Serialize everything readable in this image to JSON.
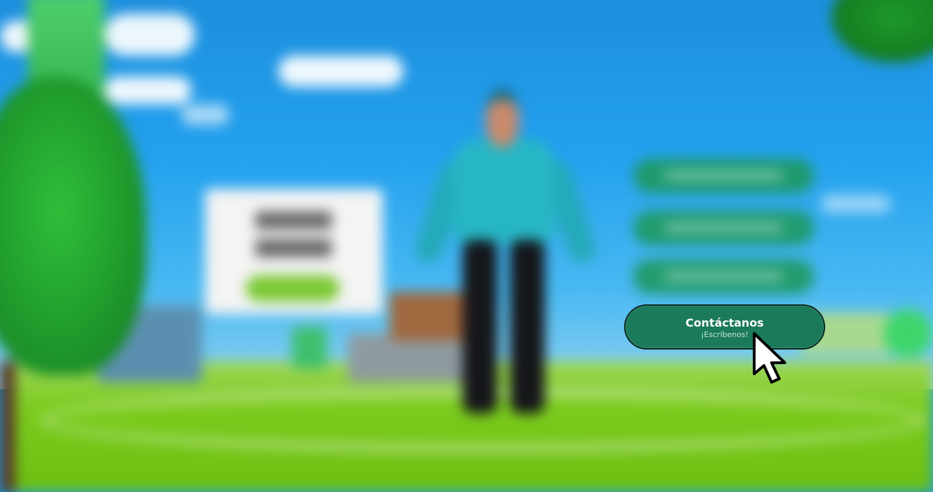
{
  "contact": {
    "title": "Contáctanos",
    "subtitle": "¡Escríbenos!"
  },
  "colors": {
    "contact_button_bg": "#1b7a5b",
    "contact_button_border": "#0a2a1f",
    "sky": "#1d8fde",
    "grass": "#7ccb1e",
    "promo_button": "#7bc934",
    "menu_button": "#1f9a63"
  },
  "icons": {
    "cursor": "arrow-cursor-icon"
  }
}
